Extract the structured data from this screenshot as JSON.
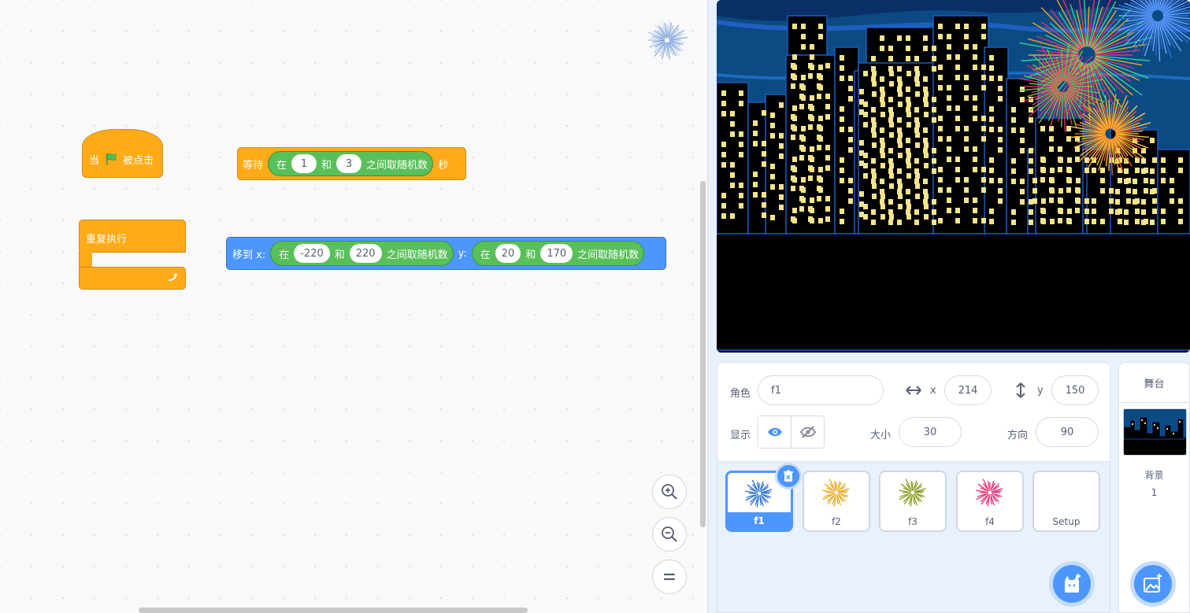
{
  "workspace": {
    "hat_block": {
      "when": "当",
      "flag_icon": "green-flag-icon",
      "clicked": "被点击"
    },
    "wait_block": {
      "label": "等待",
      "reporter": {
        "prefix": "在",
        "from": "1",
        "and": "和",
        "to": "3",
        "suffix": "之间取随机数"
      },
      "unit": "秒"
    },
    "forever_block": {
      "label": "重复执行",
      "loop_icon": "loop-arrow-icon"
    },
    "move_block": {
      "label": "移到 x:",
      "x_reporter": {
        "prefix": "在",
        "from": "-220",
        "and": "和",
        "to": "220",
        "suffix": "之间取随机数"
      },
      "y_label": "y:",
      "y_reporter": {
        "prefix": "在",
        "from": "20",
        "and": "和",
        "to": "170",
        "suffix": "之间取随机数"
      }
    },
    "zoom_buttons": [
      "zoom-in-icon",
      "zoom-out-icon",
      "zoom-reset-icon"
    ]
  },
  "sprite_info": {
    "sprite_label": "角色",
    "sprite_name": "f1",
    "x_label": "x",
    "x_value": "214",
    "y_label": "y",
    "y_value": "150",
    "show_label": "显示",
    "size_label": "大小",
    "size_value": "30",
    "direction_label": "方向",
    "direction_value": "90"
  },
  "sprites": [
    {
      "name": "f1",
      "color": "#2f6fd6",
      "selected": true
    },
    {
      "name": "f2",
      "color": "#f0a81e"
    },
    {
      "name": "f3",
      "color": "#8a9a1e"
    },
    {
      "name": "f4",
      "color": "#e8307a"
    },
    {
      "name": "Setup"
    }
  ],
  "stage_panel": {
    "title": "舞台",
    "backdrops_label": "背景",
    "backdrops_count": "1"
  },
  "colors": {
    "events": "#ffab19",
    "control": "#ffab19",
    "motion": "#4c97ff",
    "operators": "#59c059",
    "accent": "#4c97ff"
  }
}
